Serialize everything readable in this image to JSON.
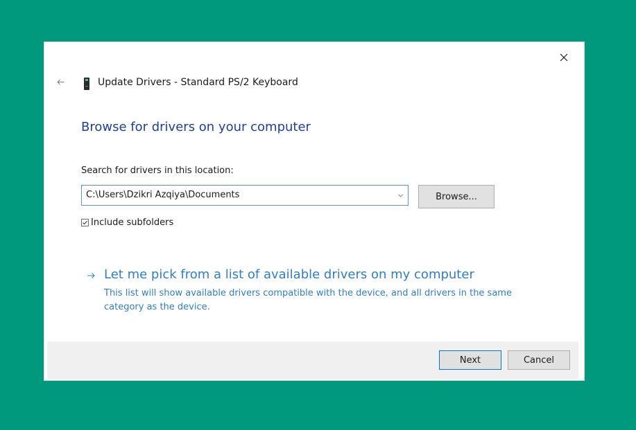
{
  "window": {
    "title": "Update Drivers - Standard PS/2 Keyboard",
    "close_icon": "close-icon",
    "back_icon": "back-arrow-icon",
    "device_icon": "keyboard-device-icon"
  },
  "main": {
    "heading": "Browse for drivers on your computer",
    "search_label": "Search for drivers in this location:",
    "path_value": "C:\\Users\\Dzikri Azqiya\\Documents",
    "browse_label": "Browse...",
    "include_subfolders_label": "Include subfolders",
    "include_subfolders_checked": true,
    "pick_link": "Let me pick from a list of available drivers on my computer",
    "pick_description": "This list will show available drivers compatible with the device, and all drivers in the same category as the device."
  },
  "footer": {
    "next_label": "Next",
    "cancel_label": "Cancel"
  },
  "colors": {
    "background": "#00997e",
    "heading": "#1e3f9a",
    "link": "#2d7fc9",
    "accent_border": "#0078d7"
  }
}
